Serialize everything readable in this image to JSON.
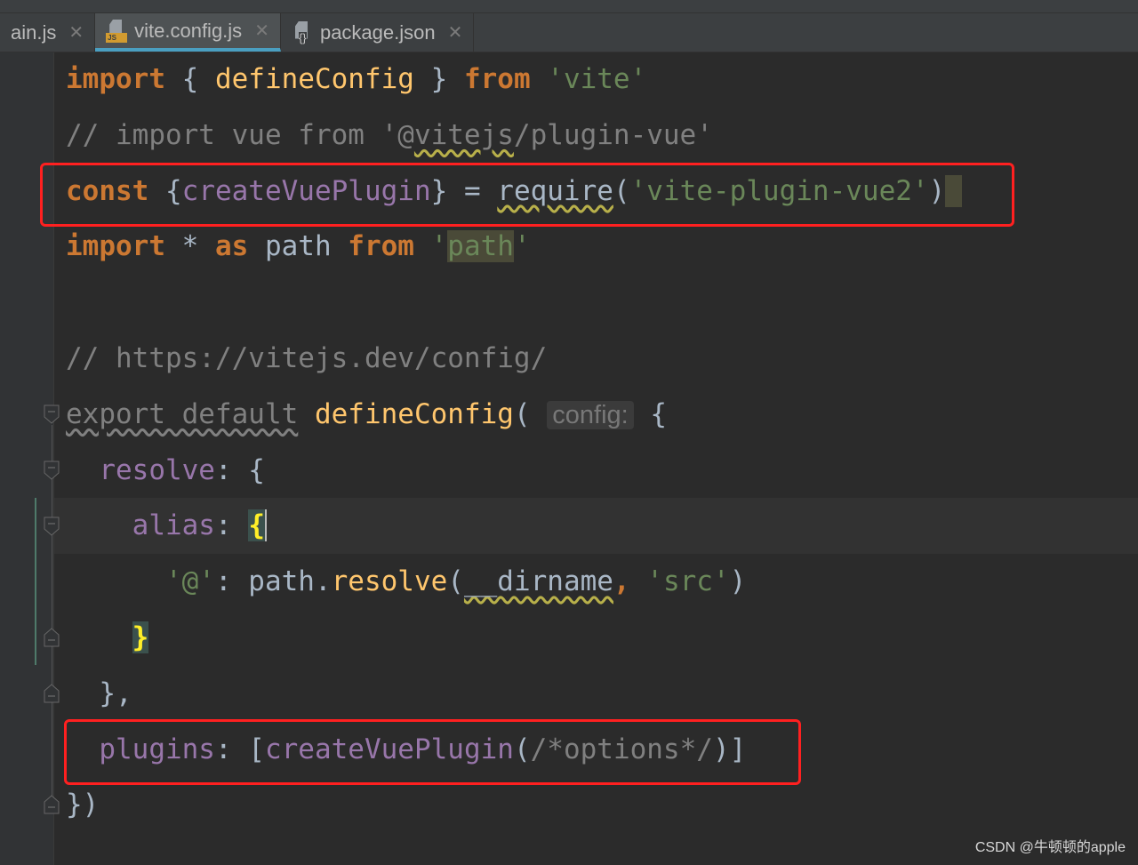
{
  "tabs": [
    {
      "label": "ain.js",
      "icon": "js-file-icon",
      "active": false
    },
    {
      "label": "vite.config.js",
      "icon": "js-file-icon",
      "active": true
    },
    {
      "label": "package.json",
      "icon": "json-file-icon",
      "active": false
    }
  ],
  "code_lines": [
    [
      {
        "t": "import",
        "c": "kw"
      },
      {
        "t": " { "
      },
      {
        "t": "defineConfig",
        "c": "fn"
      },
      {
        "t": " } "
      },
      {
        "t": "from",
        "c": "kw"
      },
      {
        "t": " "
      },
      {
        "t": "'vite'",
        "c": "str"
      }
    ],
    [
      {
        "t": "// import vue from '@",
        "c": "cm"
      },
      {
        "t": "vitejs",
        "c": "cm wavy"
      },
      {
        "t": "/plugin-vue'",
        "c": "cm"
      }
    ],
    [
      {
        "t": "const",
        "c": "kw"
      },
      {
        "t": " {"
      },
      {
        "t": "createVuePlugin",
        "c": "prop"
      },
      {
        "t": "} = "
      },
      {
        "t": "require",
        "c": "wavy"
      },
      {
        "t": "("
      },
      {
        "t": "'vite-plugin-vue2'",
        "c": "str"
      },
      {
        "t": ")"
      },
      {
        "t": " ",
        "c": "hl"
      }
    ],
    [
      {
        "t": "import",
        "c": "kw"
      },
      {
        "t": " * "
      },
      {
        "t": "as",
        "c": "kw"
      },
      {
        "t": " path "
      },
      {
        "t": "from",
        "c": "kw"
      },
      {
        "t": " "
      },
      {
        "t": "'",
        "c": "str"
      },
      {
        "t": "path",
        "c": "str hl"
      },
      {
        "t": "'",
        "c": "str"
      }
    ],
    [],
    [
      {
        "t": "// https://vitejs.dev/config/",
        "c": "cm"
      }
    ],
    [
      {
        "t": "export default",
        "c": "un"
      },
      {
        "t": " "
      },
      {
        "t": "defineConfig",
        "c": "fn"
      },
      {
        "t": "( "
      },
      {
        "t": "config:",
        "c": "hint"
      },
      {
        "t": " {"
      }
    ],
    [
      {
        "t": "  "
      },
      {
        "t": "resolve",
        "c": "prop"
      },
      {
        "t": ": {"
      }
    ],
    [
      {
        "t": "    "
      },
      {
        "t": "alias",
        "c": "prop"
      },
      {
        "t": ": "
      },
      {
        "t": "{",
        "c": "brace caret"
      }
    ],
    [
      {
        "t": "      "
      },
      {
        "t": "'@'",
        "c": "str"
      },
      {
        "t": ": path."
      },
      {
        "t": "resolve",
        "c": "fn"
      },
      {
        "t": "("
      },
      {
        "t": "__dirname",
        "c": "wavy"
      },
      {
        "t": ", ",
        "c": "kw"
      },
      {
        "t": "'src'",
        "c": "str"
      },
      {
        "t": ")"
      }
    ],
    [
      {
        "t": "    "
      },
      {
        "t": "}",
        "c": "brace"
      }
    ],
    [
      {
        "t": "  },"
      }
    ],
    [
      {
        "t": "  "
      },
      {
        "t": "plugins",
        "c": "prop"
      },
      {
        "t": ": ["
      },
      {
        "t": "createVuePlugin",
        "c": "prop"
      },
      {
        "t": "("
      },
      {
        "t": "/*options*/",
        "c": "cm"
      },
      {
        "t": ")]"
      }
    ],
    [
      {
        "t": "})"
      }
    ]
  ],
  "colors": {
    "background": "#2b2b2b",
    "keyword": "#cc7832",
    "function": "#ffc66d",
    "string": "#6a8759",
    "comment": "#808080",
    "property": "#9876aa",
    "highlight_box": "#ff2020"
  },
  "watermark": "CSDN @牛顿顿的apple"
}
